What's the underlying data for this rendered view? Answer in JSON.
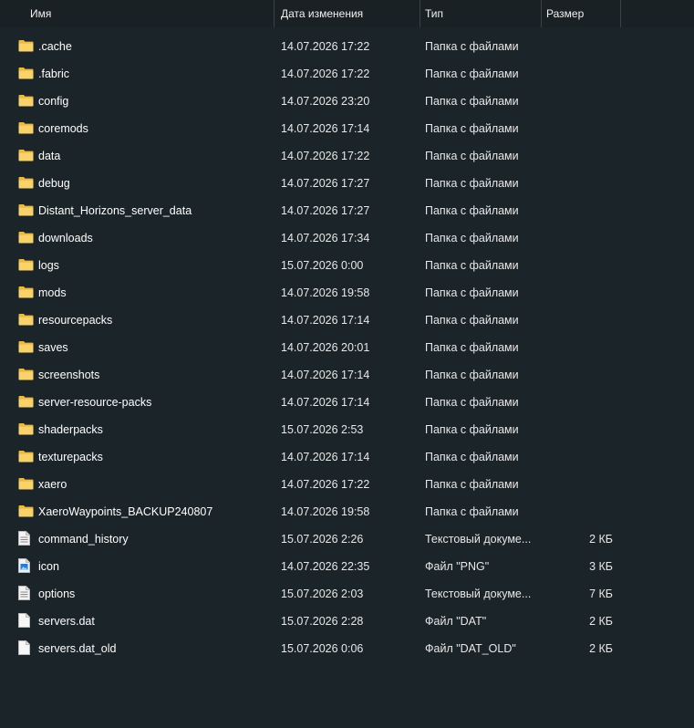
{
  "columns": {
    "name": "Имя",
    "date": "Дата изменения",
    "type": "Тип",
    "size": "Размер"
  },
  "colors": {
    "background": "#1b2428",
    "folder": "#f8d26a",
    "text": "#ffffff"
  },
  "rows": [
    {
      "icon": "folder-icon",
      "name": ".cache",
      "date": "14.07.2026 17:22",
      "type": "Папка с файлами",
      "size": ""
    },
    {
      "icon": "folder-icon",
      "name": ".fabric",
      "date": "14.07.2026 17:22",
      "type": "Папка с файлами",
      "size": ""
    },
    {
      "icon": "folder-icon",
      "name": "config",
      "date": "14.07.2026 23:20",
      "type": "Папка с файлами",
      "size": ""
    },
    {
      "icon": "folder-icon",
      "name": "coremods",
      "date": "14.07.2026 17:14",
      "type": "Папка с файлами",
      "size": ""
    },
    {
      "icon": "folder-icon",
      "name": "data",
      "date": "14.07.2026 17:22",
      "type": "Папка с файлами",
      "size": ""
    },
    {
      "icon": "folder-icon",
      "name": "debug",
      "date": "14.07.2026 17:27",
      "type": "Папка с файлами",
      "size": ""
    },
    {
      "icon": "folder-icon",
      "name": "Distant_Horizons_server_data",
      "date": "14.07.2026 17:27",
      "type": "Папка с файлами",
      "size": ""
    },
    {
      "icon": "folder-icon",
      "name": "downloads",
      "date": "14.07.2026 17:34",
      "type": "Папка с файлами",
      "size": ""
    },
    {
      "icon": "folder-icon",
      "name": "logs",
      "date": "15.07.2026 0:00",
      "type": "Папка с файлами",
      "size": ""
    },
    {
      "icon": "folder-icon",
      "name": "mods",
      "date": "14.07.2026 19:58",
      "type": "Папка с файлами",
      "size": ""
    },
    {
      "icon": "folder-icon",
      "name": "resourcepacks",
      "date": "14.07.2026 17:14",
      "type": "Папка с файлами",
      "size": ""
    },
    {
      "icon": "folder-icon",
      "name": "saves",
      "date": "14.07.2026 20:01",
      "type": "Папка с файлами",
      "size": ""
    },
    {
      "icon": "folder-icon",
      "name": "screenshots",
      "date": "14.07.2026 17:14",
      "type": "Папка с файлами",
      "size": ""
    },
    {
      "icon": "folder-icon",
      "name": "server-resource-packs",
      "date": "14.07.2026 17:14",
      "type": "Папка с файлами",
      "size": ""
    },
    {
      "icon": "folder-icon",
      "name": "shaderpacks",
      "date": "15.07.2026 2:53",
      "type": "Папка с файлами",
      "size": ""
    },
    {
      "icon": "folder-icon",
      "name": "texturepacks",
      "date": "14.07.2026 17:14",
      "type": "Папка с файлами",
      "size": ""
    },
    {
      "icon": "folder-icon",
      "name": "xaero",
      "date": "14.07.2026 17:22",
      "type": "Папка с файлами",
      "size": ""
    },
    {
      "icon": "folder-icon",
      "name": "XaeroWaypoints_BACKUP240807",
      "date": "14.07.2026 19:58",
      "type": "Папка с файлами",
      "size": ""
    },
    {
      "icon": "text-file-icon",
      "name": "command_history",
      "date": "15.07.2026 2:26",
      "type": "Текстовый докуме...",
      "size": "2 КБ"
    },
    {
      "icon": "image-file-icon",
      "name": "icon",
      "date": "14.07.2026 22:35",
      "type": "Файл \"PNG\"",
      "size": "3 КБ"
    },
    {
      "icon": "text-file-icon",
      "name": "options",
      "date": "15.07.2026 2:03",
      "type": "Текстовый докуме...",
      "size": "7 КБ"
    },
    {
      "icon": "blank-file-icon",
      "name": "servers.dat",
      "date": "15.07.2026 2:28",
      "type": "Файл \"DAT\"",
      "size": "2 КБ"
    },
    {
      "icon": "blank-file-icon",
      "name": "servers.dat_old",
      "date": "15.07.2026 0:06",
      "type": "Файл \"DAT_OLD\"",
      "size": "2 КБ"
    }
  ]
}
